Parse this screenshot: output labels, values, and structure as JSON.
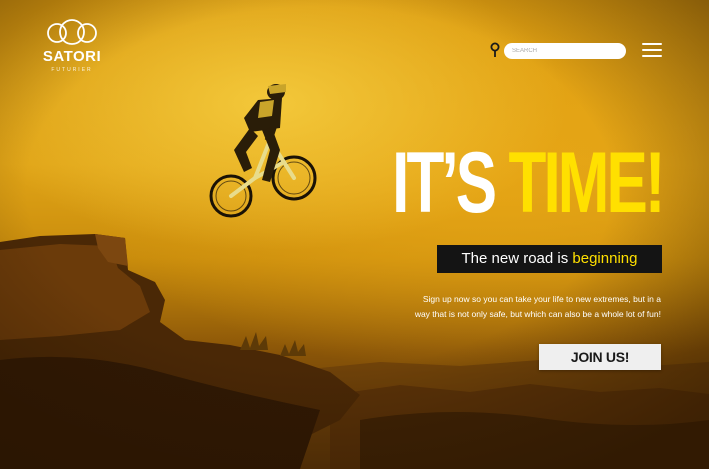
{
  "brand": {
    "name": "SATORI",
    "subtitle": "FUTURIER"
  },
  "header": {
    "search_placeholder": "SEARCH",
    "menu_icon": "hamburger-menu-icon",
    "location_icon": "map-pin-icon"
  },
  "hero": {
    "headline_part1": "IT’S ",
    "headline_part2": "TIME!",
    "tagline_part1": "The new road is ",
    "tagline_part2": "beginning",
    "body_line1": "Sign up now so you can take your life to new extremes, but in a",
    "body_line2": "way that is not only safe, but which can also be a whole lot of fun!",
    "cta_label": "JOIN US!"
  },
  "colors": {
    "accent_yellow": "#ffe000",
    "tagline_bg": "#141414",
    "sky_orange": "#e0a417"
  }
}
